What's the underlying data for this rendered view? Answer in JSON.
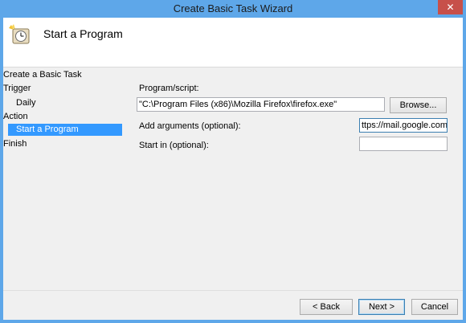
{
  "window": {
    "title": "Create Basic Task Wizard",
    "close_glyph": "✕"
  },
  "header": {
    "title": "Start a Program",
    "icon": "task-clock-icon"
  },
  "nav": {
    "items": [
      {
        "label": "Create a Basic Task"
      },
      {
        "label": "Trigger"
      },
      {
        "label": "Daily"
      },
      {
        "label": "Action"
      },
      {
        "label": "Start a Program"
      },
      {
        "label": "Finish"
      }
    ]
  },
  "form": {
    "program_label": "Program/script:",
    "program_value": "\"C:\\Program Files (x86)\\Mozilla Firefox\\firefox.exe\"",
    "browse_label": "Browse...",
    "args_label": "Add arguments (optional):",
    "args_value": "ttps://mail.google.com/",
    "startin_label": "Start in (optional):",
    "startin_value": ""
  },
  "footer": {
    "back_label": "< Back",
    "next_label": "Next >",
    "cancel_label": "Cancel"
  },
  "colors": {
    "title_bar": "#5ea7e9",
    "selection": "#3399ff",
    "close_button": "#c7504a"
  }
}
